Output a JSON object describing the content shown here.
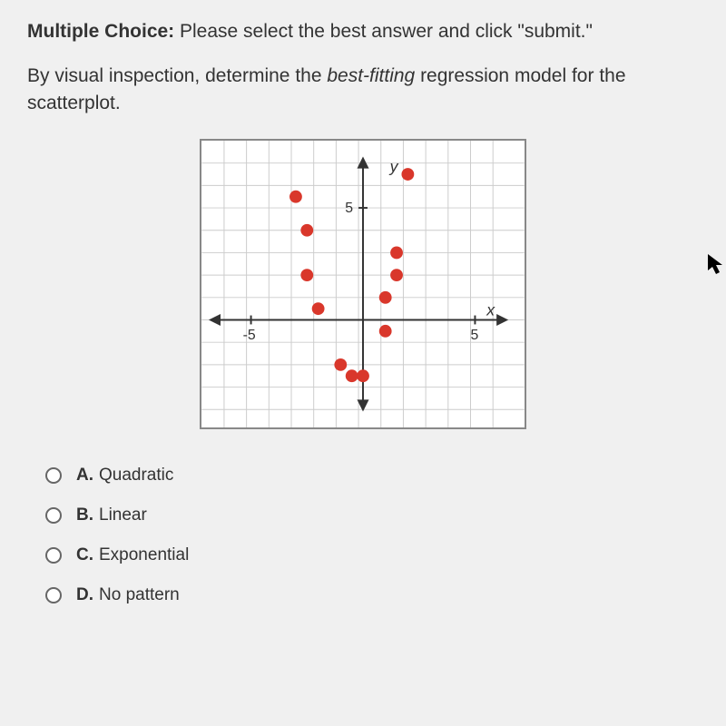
{
  "instruction": {
    "prefix": "Multiple Choice:",
    "text": " Please select the best answer and click \"submit.\""
  },
  "question": {
    "part1": "By visual inspection, determine the ",
    "emphasis": "best-fitting ",
    "part2": "regression model for the scatterplot."
  },
  "options": [
    {
      "letter": "A.",
      "label": "Quadratic"
    },
    {
      "letter": "B.",
      "label": "Linear"
    },
    {
      "letter": "C.",
      "label": "Exponential"
    },
    {
      "letter": "D.",
      "label": "No pattern"
    }
  ],
  "chart_data": {
    "type": "scatter",
    "title": "",
    "xlabel": "x",
    "ylabel": "y",
    "xlim": [
      -8,
      8
    ],
    "ylim": [
      -5,
      9
    ],
    "xticks": [
      -5,
      5
    ],
    "yticks": [
      5
    ],
    "points": [
      {
        "x": -3,
        "y": 5.5
      },
      {
        "x": -2.5,
        "y": 4
      },
      {
        "x": -2.5,
        "y": 2
      },
      {
        "x": -2,
        "y": 0.5
      },
      {
        "x": -1,
        "y": -2
      },
      {
        "x": -0.5,
        "y": -2.5
      },
      {
        "x": 0,
        "y": -2.5
      },
      {
        "x": 1,
        "y": -0.5
      },
      {
        "x": 1,
        "y": 1
      },
      {
        "x": 1.5,
        "y": 2
      },
      {
        "x": 1.5,
        "y": 3
      },
      {
        "x": 2,
        "y": 6.5
      }
    ]
  }
}
